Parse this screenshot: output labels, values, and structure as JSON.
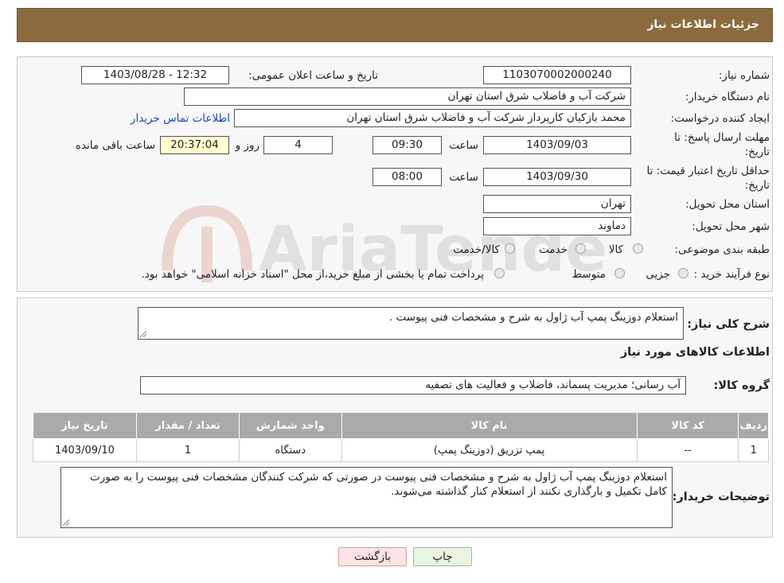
{
  "header": {
    "title": "جزئیات اطلاعات نیاز"
  },
  "fields": {
    "need_number_label": "شماره نیاز:",
    "need_number": "1103070002000240",
    "announce_label": "تاریخ و ساعت اعلان عمومی:",
    "announce_value": "1403/08/28 - 12:32",
    "buyer_label": "نام دستگاه خریدار:",
    "buyer_value": "شرکت آب و فاضلاب شرق استان تهران",
    "creator_label": "ایجاد کننده درخواست:",
    "creator_value": "محمد بازکیان کارپرداز شرکت آب و فاضلاب شرق استان تهران",
    "contact_link": "اطلاعات تماس خریدار",
    "deadline_label_1": "مهلت ارسال پاسخ: تا",
    "deadline_label_2": "تاریخ:",
    "deadline_date": "1403/09/03",
    "time_label": "ساعت",
    "deadline_time": "09:30",
    "days_value": "4",
    "days_label": "روز و",
    "remaining_time": "20:37:04",
    "remaining_label": "ساعت باقی مانده",
    "validity_label_1": "حداقل تاریخ اعتبار قیمت: تا",
    "validity_label_2": "تاریخ:",
    "validity_date": "1403/09/30",
    "validity_time": "08:00",
    "province_label": "استان محل تحویل:",
    "province_value": "تهران",
    "city_label": "شهر محل تحویل:",
    "city_value": "دماوند",
    "category_label": "طبقه بندی موضوعی:",
    "category_options": [
      "کالا",
      "خدمت",
      "کالا/خدمت"
    ],
    "process_label": "نوع فرآیند خرید :",
    "process_options": [
      "جزیی",
      "متوسط"
    ],
    "process_note": "پرداخت تمام یا بخشی از مبلغ خرید،از محل \"اسناد خزانه اسلامی\" خواهد بود."
  },
  "details": {
    "desc_label": "شرح کلی نیاز:",
    "desc_value": "استعلام دوزینگ پمپ آب ژاول به شرح و مشخصات فنی پیوست .",
    "goods_info_title": "اطلاعات کالاهای مورد نیاز",
    "group_label": "گروه کالا:",
    "group_value": "آب رسانی؛ مدیریت پسماند، فاضلاب و فعالیت های تصفیه",
    "table": {
      "headers": [
        "ردیف",
        "کد کالا",
        "نام کالا",
        "واحد شمارش",
        "تعداد / مقدار",
        "تاریخ نیاز"
      ],
      "rows": [
        [
          "1",
          "--",
          "پمپ تزریق (دوزینگ پمپ)",
          "دستگاه",
          "1",
          "1403/09/10"
        ]
      ]
    },
    "buyer_notes_label": "توضیحات خریدار:",
    "buyer_notes_value": "استعلام دوزینگ پمپ آب ژاول به شرح و مشخصات فنی پیوست در صورتی که شرکت کنندگان مشخصات فنی پیوست را به صورت کامل تکمیل و بارگذاری نکنند از استعلام کنار گذاشته می‌شوند."
  },
  "buttons": {
    "print": "چاپ",
    "back": "بازگشت"
  },
  "watermark": "AriaTender.neT",
  "colors": {
    "header_bg": "#8b6b3d",
    "link": "#1a3fcc",
    "timer_bg": "#ffffd0"
  }
}
